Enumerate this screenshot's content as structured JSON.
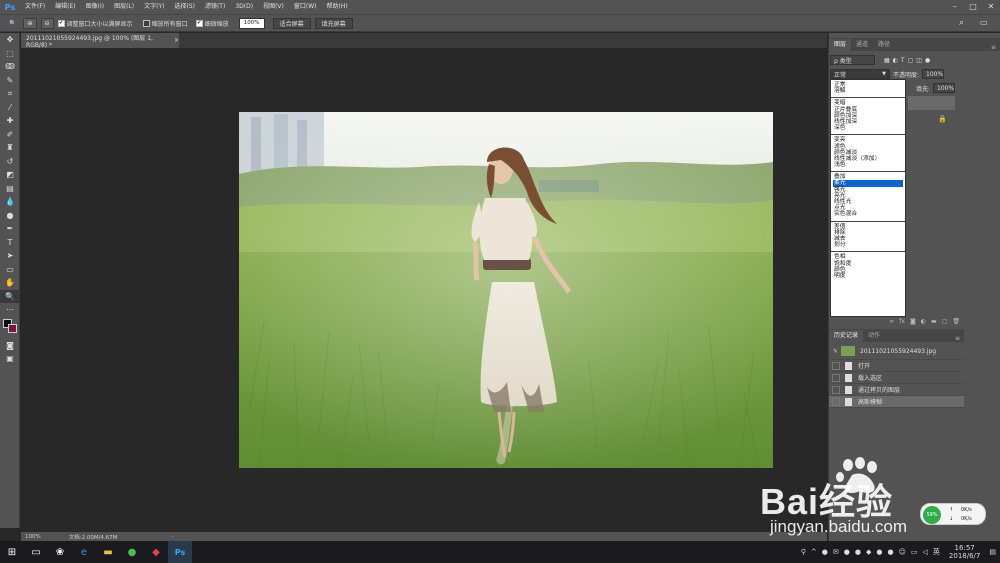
{
  "menubar": {
    "logo": "Ps",
    "items": [
      "文件(F)",
      "编辑(E)",
      "图像(I)",
      "图层(L)",
      "文字(Y)",
      "选择(S)",
      "滤镜(T)",
      "3D(D)",
      "视图(V)",
      "窗口(W)",
      "帮助(H)"
    ]
  },
  "options": {
    "resize_windows": "调整窗口大小以满屏显示",
    "zoom_all": "缩放所有窗口",
    "scrubby_zoom": "细微缩放",
    "zoom_value": "100%",
    "fit_screen": "适合屏幕",
    "fill_screen": "填充屏幕"
  },
  "document": {
    "tab_title": "20111021055924493.jpg @ 100% (图层 1, RGB/8) *",
    "close": "×"
  },
  "status": {
    "zoom": "100%",
    "doc_info": "文档:2.00M/4.67M"
  },
  "layers": {
    "tabs": [
      "图层",
      "通道",
      "路径"
    ],
    "filter_kind": "ρ 类型",
    "blend_mode": "正常",
    "opacity_label": "不透明度:",
    "opacity_value": "100%",
    "fill_label": "填充:",
    "fill_value": "100%",
    "blend_groups": [
      [
        "正常",
        "溶解"
      ],
      [
        "变暗",
        "正片叠底",
        "颜色加深",
        "线性加深",
        "深色"
      ],
      [
        "变亮",
        "滤色",
        "颜色减淡",
        "线性减淡（添加）",
        "浅色"
      ],
      [
        "叠加",
        "柔光",
        "强光",
        "亮光",
        "线性光",
        "点光",
        "实色混合"
      ],
      [
        "差值",
        "排除",
        "减去",
        "划分"
      ],
      [
        "色相",
        "饱和度",
        "颜色",
        "明度"
      ]
    ],
    "selected_mode": "柔光",
    "bottom_icons": [
      "link-icon",
      "fx-icon",
      "mask-icon",
      "adjustment-icon",
      "folder-icon",
      "new-layer-icon",
      "trash-icon"
    ]
  },
  "history": {
    "tabs": [
      "历史记录",
      "动作"
    ],
    "snapshot": "20111021055924493.jpg",
    "items": [
      "打开",
      "载入选区",
      "通过拷贝的图层",
      "高斯模糊"
    ]
  },
  "taskbar": {
    "time": "16:57",
    "date": "2018/6/7",
    "lang": "英",
    "net_up": "0K/s",
    "net_down": "0K/s",
    "cpu": "59%"
  },
  "watermark": {
    "brand": "Bai经验",
    "url": "jingyan.baidu.com"
  }
}
